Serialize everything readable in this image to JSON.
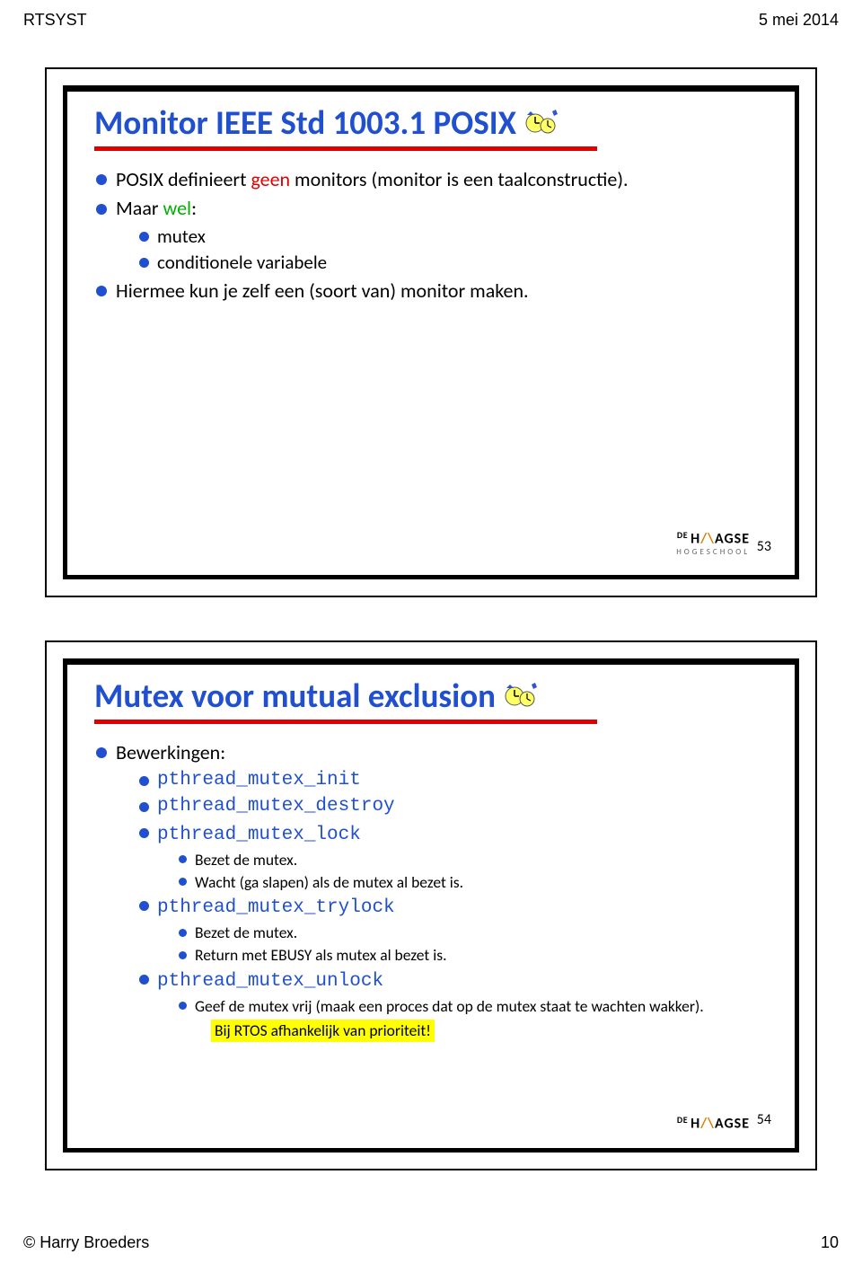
{
  "header": {
    "left": "RTSYST",
    "right": "5 mei 2014"
  },
  "footer": {
    "left": "© Harry Broeders",
    "right": "10"
  },
  "logo": {
    "de": "DE",
    "haagse_pre": "H",
    "haagse_slash": "/\\",
    "haagse_post": "AGSE",
    "sub": "HOGESCHOOL"
  },
  "slide1": {
    "title": "Monitor IEEE Std 1003.1 POSIX",
    "num": "53",
    "items": [
      {
        "pre": "POSIX definieert ",
        "geen": "geen",
        "post": " monitors (monitor is een taalconstructie)."
      },
      {
        "pre": "Maar ",
        "wel": "wel",
        "post": ":"
      }
    ],
    "sub": [
      "mutex",
      "conditionele variabele"
    ],
    "last": "Hiermee kun je zelf een (soort van) monitor maken."
  },
  "slide2": {
    "title": "Mutex voor mutual exclusion",
    "num": "54",
    "b1": "Bewerkingen:",
    "ops": {
      "init": "pthread_mutex_init",
      "destroy": "pthread_mutex_destroy",
      "lock": "pthread_mutex_lock",
      "lock_sub": [
        "Bezet de mutex.",
        "Wacht (ga slapen) als de mutex al bezet is."
      ],
      "trylock": "pthread_mutex_trylock",
      "trylock_sub": [
        "Bezet de mutex.",
        "Return met EBUSY als mutex al bezet is."
      ],
      "unlock": "pthread_mutex_unlock",
      "unlock_sub": "Geef de mutex vrij (maak een proces dat op de mutex staat te wachten wakker)."
    },
    "highlight": "Bij RTOS afhankelijk van prioriteit!"
  }
}
